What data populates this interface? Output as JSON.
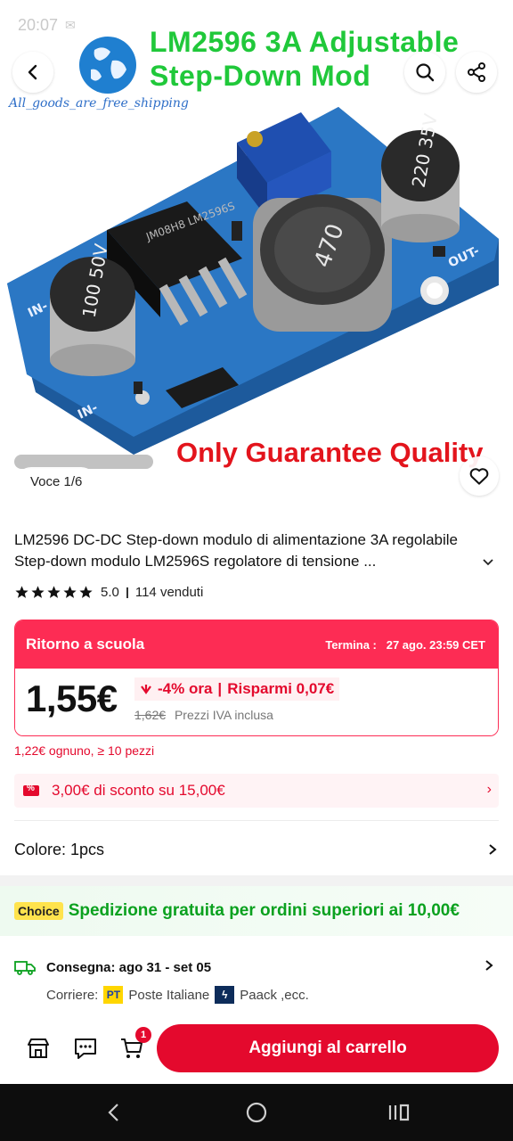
{
  "status_bar": {
    "time": "20:07",
    "right": ""
  },
  "hero": {
    "brand_text": "All_goods_are_free_shipping",
    "title_line1": "LM2596 3A Adjustable",
    "title_line2": "Step-Down Mod",
    "quality_text": "Only Guarantee Quality",
    "image_counter": "Voce 1/6",
    "pcb_labels": {
      "cap1": "100 50V",
      "cap2": "220 35V",
      "inductor": "470",
      "chip": "JM08H8 LM2596S",
      "in_label": "IN-",
      "out_label": "OUT-"
    }
  },
  "product": {
    "title": "LM2596 DC-DC Step-down modulo di alimentazione 3A regolabile Step-down modulo LM2596S regolatore di tensione ...",
    "rating": "5.0",
    "sold": "114 venduti"
  },
  "promo": {
    "name": "Ritorno a scuola",
    "ends_label": "Termina :",
    "ends_value": "27 ago. 23:59 CET",
    "price": "1,55€",
    "discount": "-4% ora",
    "saving": "Risparmi 0,07€",
    "old_price": "1,62€",
    "vat_note": "Prezzi IVA inclusa"
  },
  "bulk_price": "1,22€ ognuno, ≥ 10 pezzi",
  "coupon": "3,00€ di sconto su 15,00€",
  "color_option": "Colore: 1pcs",
  "shipping": {
    "badge": "Choice",
    "banner": "Spedizione gratuita per ordini superiori ai 10,00€",
    "delivery_label": "Consegna: ago 31 - set 05",
    "carrier_label": "Corriere:",
    "carrier1_logo": "PT",
    "carrier1": "Poste Italiane",
    "carrier2_logo": "ϟ",
    "carrier2": "Paack ,ecc."
  },
  "action_bar": {
    "cart_count": "1",
    "add_to_cart": "Aggiungi al carrello"
  },
  "colors": {
    "accent": "#e4092d",
    "promo_red": "#fd2c54",
    "green": "#0ba11f",
    "title_green": "#20c83a"
  }
}
